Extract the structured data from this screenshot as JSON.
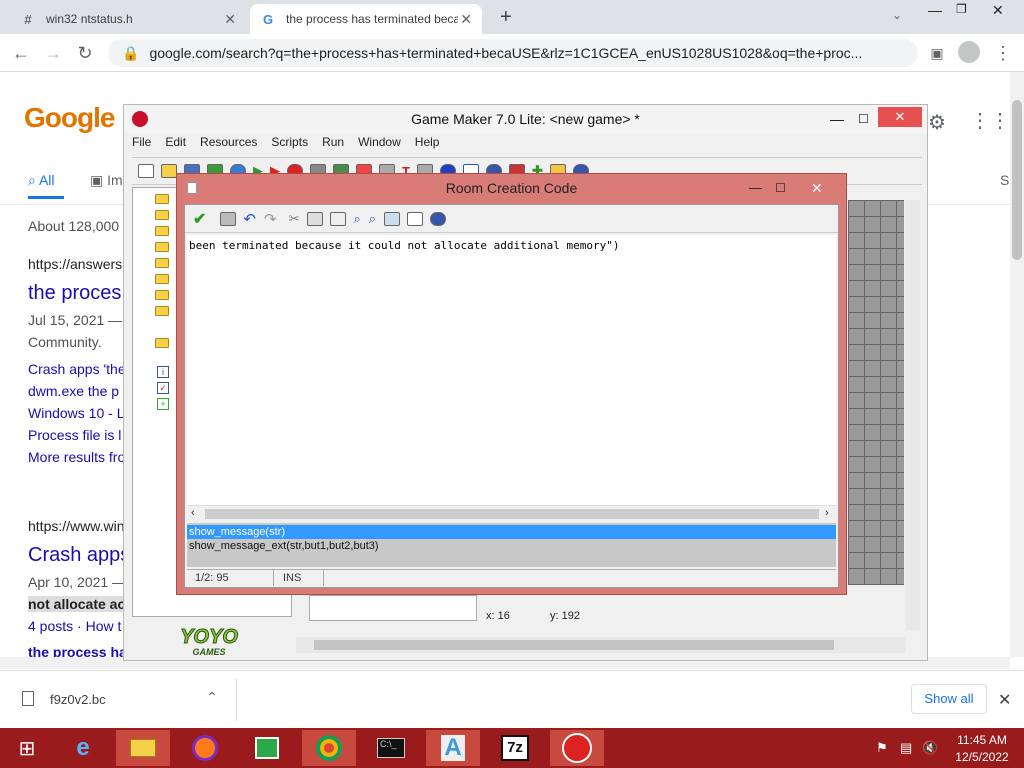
{
  "browser": {
    "tabs": [
      {
        "icon": "#",
        "title": "win32 ntstatus.h"
      },
      {
        "icon": "G",
        "title": "the process has terminated beca"
      }
    ],
    "new_tab": "+",
    "url": "google.com/search?q=the+process+has+terminated+becaUSE&rlz=1C1GCEA_enUS1028US1028&oq=the+proc..."
  },
  "google": {
    "logo": "Google",
    "tab_all": "All",
    "tab_images_partial": "Im",
    "tab_s": "S",
    "about": "About 128,000",
    "result1_url": "https://answers",
    "result1_title": "the proces",
    "result1_date": "Jul 15, 2021 —",
    "result1_snip": "Community.",
    "result1_links": [
      "Crash apps 'the",
      "dwm.exe the p",
      "Windows 10 - L",
      "Process file is l",
      "More results fro"
    ],
    "result2_url": "https://www.win",
    "result2_title": "Crash apps",
    "result2_date": "Apr 10, 2021 —",
    "result2_snip_hl": "not allocate ac",
    "result2_posts": "4 posts · How t",
    "result3_title": "the process ha"
  },
  "gamemaker": {
    "title": "Game Maker 7.0 Lite: <new game> *",
    "menu": [
      "File",
      "Edit",
      "Resources",
      "Scripts",
      "Run",
      "Window",
      "Help"
    ],
    "logo_main": "YOYO",
    "logo_sub": "GAMES",
    "coord_x": "x: 16",
    "coord_y": "y: 192"
  },
  "room_code": {
    "title": "Room Creation Code",
    "code": "been terminated because it could not allocate additional memory\")",
    "suggestions": [
      "show_message(str)",
      "show_message_ext(str,but1,but2,but3)"
    ],
    "position": "1/2:  95",
    "mode": "INS"
  },
  "downloads": {
    "file": "f9z0v2.bc",
    "show_all": "Show all"
  },
  "taskbar": {
    "time": "11:45 AM",
    "date": "12/5/2022"
  },
  "colors": {
    "accent": "#1a73e8",
    "taskbar": "#9a1b1b",
    "dialog": "#d97b77"
  }
}
